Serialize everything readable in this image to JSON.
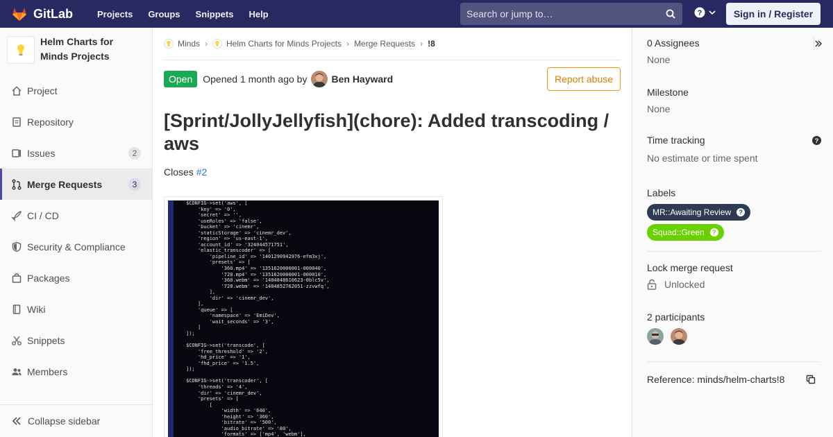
{
  "topbar": {
    "brand": "GitLab",
    "nav": [
      "Projects",
      "Groups",
      "Snippets",
      "Help"
    ],
    "search_placeholder": "Search or jump to…",
    "signin_label": "Sign in / Register",
    "colors": {
      "navbar": "#292961",
      "logo_orange": "#fc6d26"
    }
  },
  "sidebar": {
    "project_name": "Helm Charts for Minds Projects",
    "items": [
      {
        "label": "Project",
        "icon": "home-icon",
        "count": null
      },
      {
        "label": "Repository",
        "icon": "doc-icon",
        "count": null
      },
      {
        "label": "Issues",
        "icon": "issues-icon",
        "count": "2"
      },
      {
        "label": "Merge Requests",
        "icon": "merge-request-icon",
        "count": "3",
        "active": true
      },
      {
        "label": "CI / CD",
        "icon": "rocket-icon",
        "count": null
      },
      {
        "label": "Security & Compliance",
        "icon": "shield-icon",
        "count": null
      },
      {
        "label": "Packages",
        "icon": "package-icon",
        "count": null
      },
      {
        "label": "Wiki",
        "icon": "book-icon",
        "count": null
      },
      {
        "label": "Snippets",
        "icon": "scissors-icon",
        "count": null
      },
      {
        "label": "Members",
        "icon": "users-icon",
        "count": null
      }
    ],
    "collapse_label": "Collapse sidebar"
  },
  "breadcrumb": {
    "items": [
      "Minds",
      "Helm Charts for Minds Projects",
      "Merge Requests"
    ],
    "current": "!8"
  },
  "mr": {
    "status": "Open",
    "opened_text": "Opened 1 month ago by",
    "author": "Ben Hayward",
    "report_label": "Report abuse",
    "title": "[Sprint/JollyJellyfish](chore): Added transcoding / aws",
    "closes_label": "Closes",
    "closes_link": "#2",
    "code_lines": [
      "$CONFIG->set('aws', [",
      "    'key' => '0',",
      "    'secret' => '',",
      "    'useRoles' => 'false',",
      "    'bucket' => 'cinemr',",
      "    'staticStorage' => 'cinemr_dev',",
      "    'region' => 'us-east-1',",
      "    'account_id' => '324044571751',",
      "    'elastic_transcoder' => [",
      "        'pipeline_id' => '1401290942976-efm3xj',",
      "        'presets' => [",
      "            '360.mp4' => '1351620000001-000040',",
      "            '720.mp4' => '1351620000001-000010',",
      "            '360.webm' => '1404848610623-0blc5v',",
      "            '720.webm' => '1404852762051-zzvwfq',",
      "        ],",
      "        'dir' => 'cinemr_dev',",
      "    ],",
      "    'queue' => [",
      "        'namespace' => 'EmiDev',",
      "        'wait_seconds' => '3',",
      "    ]",
      "]);",
      "",
      "$CONFIG->set('transcode', [",
      "    'free_threshold' => '2',",
      "    'hd_price' => '1',",
      "    'fhd_price' => '1.5',",
      "]);",
      "",
      "$CONFIG->set('transcoder', [",
      "    'threads' => '4',",
      "    'dir' => 'cinemr_dev',",
      "    'presets' => [",
      "        [",
      "            'width' => '640',",
      "            'height' => '360',",
      "            'bitrate' => '500',",
      "            'audio_bitrate' => '80',",
      "            'formats' => ['mp4', 'webm'],"
    ]
  },
  "rsidebar": {
    "assignees_title": "0 Assignees",
    "assignees_value": "None",
    "milestone_title": "Milestone",
    "milestone_value": "None",
    "time_title": "Time tracking",
    "time_value": "No estimate or time spent",
    "labels_title": "Labels",
    "labels": [
      {
        "text": "MR::Awaiting Review",
        "color": "#2f3b54"
      },
      {
        "text": "Squad::Green",
        "color": "#69d100"
      }
    ],
    "lock_title": "Lock merge request",
    "lock_value": "Unlocked",
    "participants_title": "2 participants",
    "reference": "Reference: minds/helm-charts!8"
  }
}
